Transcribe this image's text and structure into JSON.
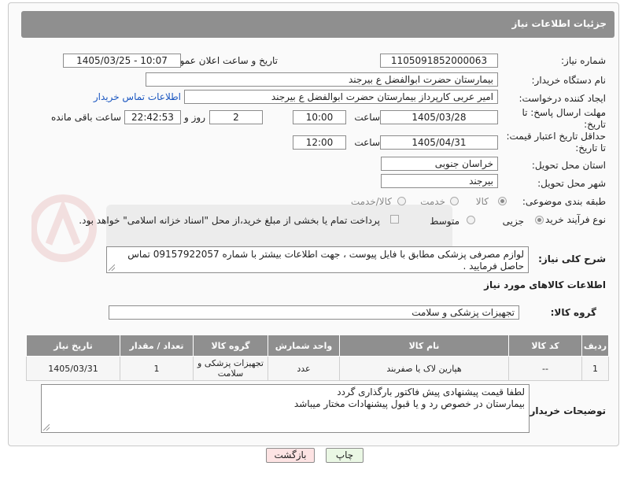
{
  "header": {
    "title": "جزئیات اطلاعات نیاز"
  },
  "form": {
    "need_number_label": "شماره نیاز:",
    "need_number": "1105091852000063",
    "announce_label": "تاریخ و ساعت اعلان عمومی:",
    "announce_value": "1405/03/25 - 10:07",
    "buyer_org_label": "نام دستگاه خریدار:",
    "buyer_org": "بیمارستان حضرت ابوالفضل  ع  بیرجند",
    "requester_label": "ایجاد کننده درخواست:",
    "requester": "امیر عربی کارپرداز بیمارستان حضرت ابوالفضل  ع  بیرجند",
    "contact_link": "اطلاعات تماس خریدار",
    "deadline_label_1": "مهلت ارسال پاسخ: تا",
    "deadline_label_2": "تاریخ:",
    "deadline_date": "1405/03/28",
    "time_label": "ساعت",
    "deadline_time": "10:00",
    "days_value": "2",
    "days_label": "روز و",
    "remaining_time": "22:42:53",
    "remaining_label": "ساعت باقی مانده",
    "validity_label_1": "حداقل تاریخ اعتبار قیمت:",
    "validity_label_2": "تا تاریخ:",
    "validity_date": "1405/04/31",
    "validity_time": "12:00",
    "province_label": "استان محل تحویل:",
    "province": "خراسان جنوبی",
    "city_label": "شهر محل تحویل:",
    "city": "بیرجند",
    "category_label": "طبقه بندی موضوعی:",
    "category_options": [
      "کالا",
      "خدمت",
      "کالا/خدمت"
    ],
    "category_selected": "کالا",
    "process_label": "نوع فرآیند خرید :",
    "process_options": [
      "جزیی",
      "متوسط"
    ],
    "process_selected": "جزیی",
    "payment_note": "پرداخت تمام یا بخشی از مبلغ خرید،از محل \"اسناد خزانه اسلامی\" خواهد بود.",
    "description_label": "شرح کلی نیاز:",
    "description": "لوازم مصرفی پزشکی مطابق با فایل پیوست ، جهت اطلاعات بیشتر با شماره 09157922057 تماس حاصل فرمایید ."
  },
  "goods": {
    "section_title": "اطلاعات کالاهای مورد نیاز",
    "group_label": "گروه کالا:",
    "group_value": "تجهیزات پزشکی و سلامت",
    "columns": [
      "ردیف",
      "کد کالا",
      "نام کالا",
      "واحد شمارش",
      "گروه کالا",
      "تعداد / مقدار",
      "تاریخ نیاز"
    ],
    "rows": [
      [
        "1",
        "--",
        "هپارین لاک یا صفربند",
        "عدد",
        "تجهیزات پزشکی و سلامت",
        "1",
        "1405/03/31"
      ]
    ]
  },
  "buyer_notes": {
    "label": "توضیحات خریدار:",
    "line1": "لطفا قیمت پیشنهادی پیش فاکتور بارگذاری گردد",
    "line2": "بیمارستان در خصوص رد و یا قبول پیشنهادات مختار میباشد"
  },
  "buttons": {
    "print": "چاپ",
    "back": "بازگشت"
  },
  "colors": {
    "header_bg": "#8f8f8f",
    "link": "#1a56c0",
    "back_button_bg": "#fde3e3",
    "print_button_bg": "#eaf7e4"
  }
}
